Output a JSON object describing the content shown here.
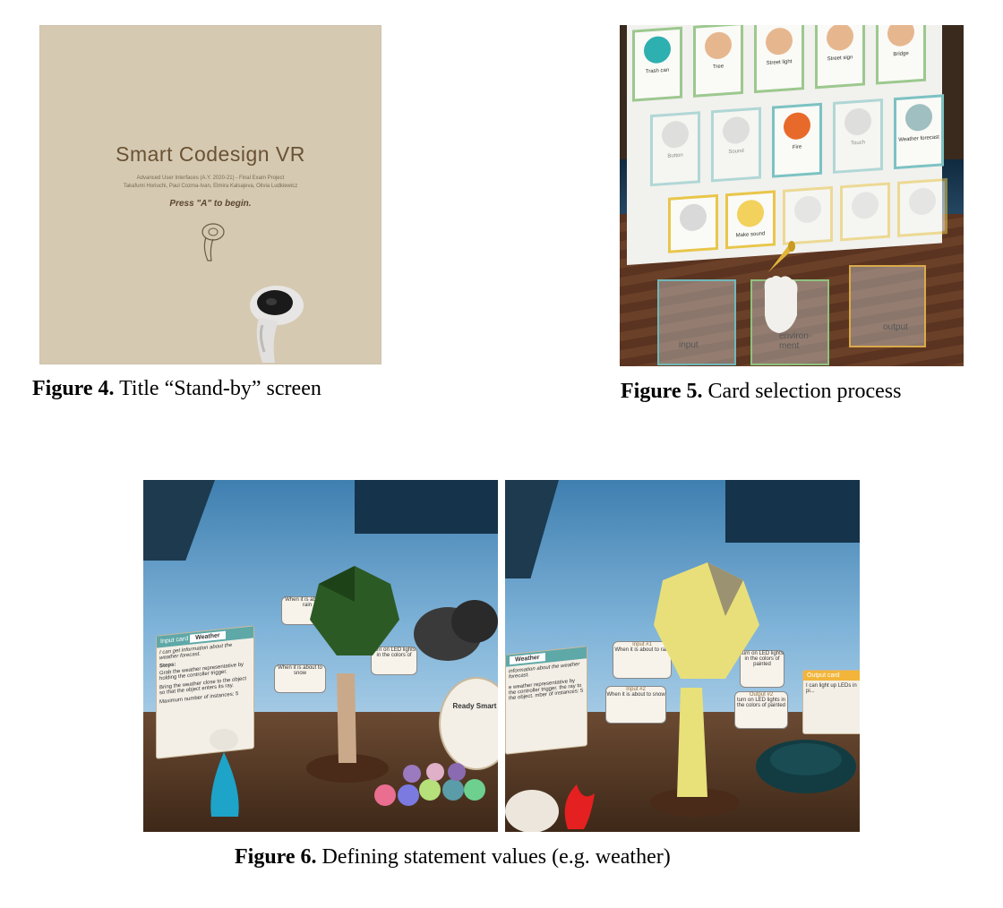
{
  "figure4": {
    "title": "Smart Codesign VR",
    "subtitle_line1": "Advanced User Interfaces (A.Y. 2020-21) - Final Exam Project",
    "subtitle_line2": "Takafumi Horiuchi, Paul Cozma-Ivan, Elmira Kalsajeva, Olivia Ludkiewicz",
    "press": "Press \"A\" to begin.",
    "caption_label": "Figure 4.",
    "caption_text": " Title “Stand-by” screen"
  },
  "figure5": {
    "cards_row1": [
      "Trash can",
      "Tree",
      "Street light",
      "Street sign",
      "Bridge"
    ],
    "cards_row2": [
      "Button",
      "Sound",
      "Fire",
      "Touch",
      "Weather forecast"
    ],
    "cards_row3": [
      "",
      "Make sound",
      "",
      "",
      ""
    ],
    "box_labels": [
      "input",
      "environ-ment",
      "output"
    ],
    "caption_label": "Figure 5.",
    "caption_text": " Card selection process"
  },
  "figure6": {
    "left": {
      "input_card_header": "Input card",
      "input_card_tag": "Weather",
      "input_card_text": "I can get information about the weather forecast.",
      "steps_label": "Steps:",
      "step1": "Grab the weather representative by holding the controller trigger.",
      "step2": "Bring the weather close to the object so that the object enters its ray.",
      "max_instances": "Maximum number of instances: 5",
      "bubble_input1": "When it is about to rain",
      "bubble_input2": "When it is about to snow",
      "bubble_output": "turn on LED lights in the colors of",
      "ready_text": "Ready Smart"
    },
    "right": {
      "input_card_tag": "Weather",
      "input_card_text": "information about the weather forecast.",
      "bubble_input1_title": "Input #1",
      "bubble_input1": "When it is about to rain",
      "bubble_input2_title": "Input #2",
      "bubble_input2": "When it is about to snow",
      "bubble_output1": "turn on LED lights in the colors of painted",
      "bubble_output2_title": "Output #2",
      "bubble_output2": "turn on LED lights in the colors of painted",
      "output_card_header": "Output card",
      "output_card_text": "I can light up LEDs in pi...",
      "right_text": "e weather representative by the controller trigger. the ray to the object. mber of instances: 5"
    },
    "caption_label": "Figure 6.",
    "caption_text": " Defining statement values (e.g. weather)"
  }
}
